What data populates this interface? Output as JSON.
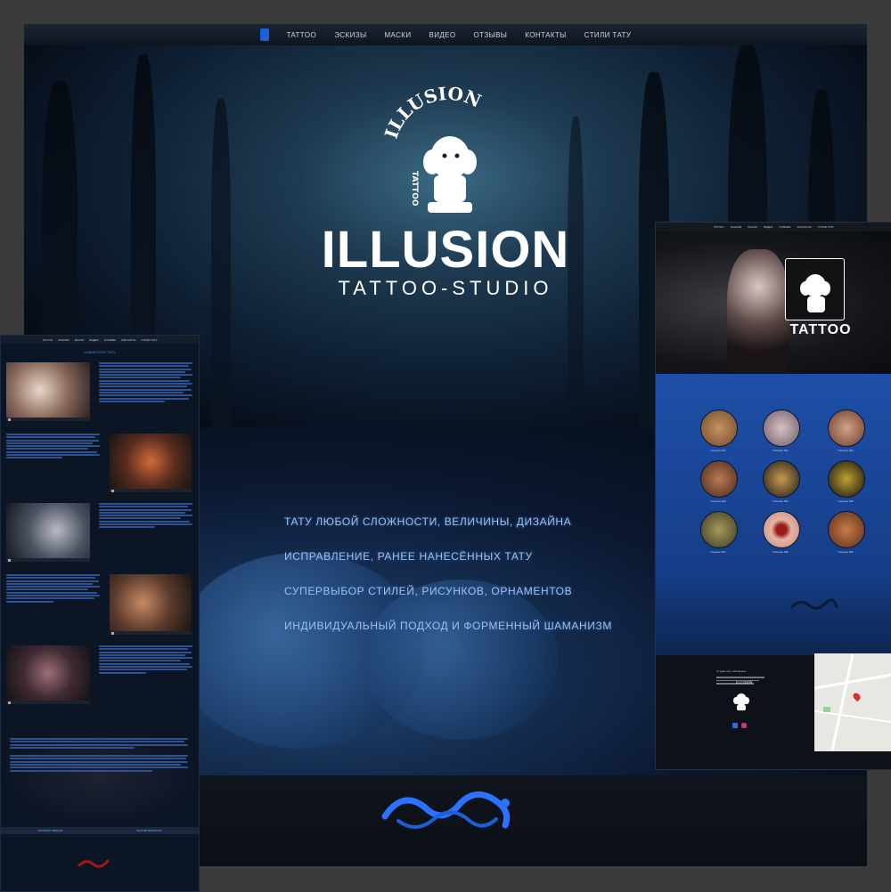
{
  "main": {
    "nav": [
      "TATTOO",
      "ЭСКИЗЫ",
      "МАСКИ",
      "ВИДЕО",
      "ОТЗЫВЫ",
      "КОНТАКТЫ",
      "СТИЛИ ТАТУ"
    ],
    "brand_title": "ILLUSION",
    "brand_subtitle": "TATTOO-STUDIO",
    "emblem_text": "ILLUSION",
    "emblem_sub": "TATTOO",
    "services": [
      "ТАТУ ЛЮБОЙ СЛОЖНОСТИ, ВЕЛИЧИНЫ, ДИЗАЙНА",
      "ИСПРАВЛЕНИЕ, РАНЕЕ НАНЕСЁННЫХ ТАТУ",
      "СУПЕРВЫБОР СТИЛЕЙ, РИСУНКОВ, ОРНАМЕНТОВ",
      "ИНДИВИДУАЛЬНЫЙ ПОДХОД И ФОРМЕННЫЙ ШАМАНИЗМ"
    ]
  },
  "left": {
    "nav": [
      "TATTOO",
      "ЭСКИЗЫ",
      "МАСКИ",
      "ВИДЕО",
      "ОТЗЫВЫ",
      "КОНТАКТЫ",
      "СТИЛИ ТАТУ"
    ],
    "title": "НАВИКОЛОЕ ТАТУ",
    "footer": [
      "ЗАКАЗАТЬ ЗВОНОК",
      "ЧАСТЫЕ ВОПРОСЫ"
    ]
  },
  "right": {
    "nav": [
      "TATTOO",
      "ЭСКИЗЫ",
      "МАСКИ",
      "ВИДЕО",
      "ОТЗЫВЫ",
      "КОНТАКТЫ",
      "СТИЛИ ТАТУ"
    ],
    "hero_title": "TATTOO",
    "gallery": [
      "Галерея №1",
      "Галерея №2",
      "Галерея №3",
      "Галерея №4",
      "Галерея №5",
      "Галерея №6",
      "Галерея №7",
      "Галерея №8",
      "Галерея №9"
    ],
    "footer_studio": "Студия тату «Иллюзия»",
    "footer_brand": "ILLUSION"
  },
  "colors": {
    "accent": "#1d5fd8",
    "service_text": "#9fc0ee",
    "gallery_bg": "#1e4fa8"
  }
}
